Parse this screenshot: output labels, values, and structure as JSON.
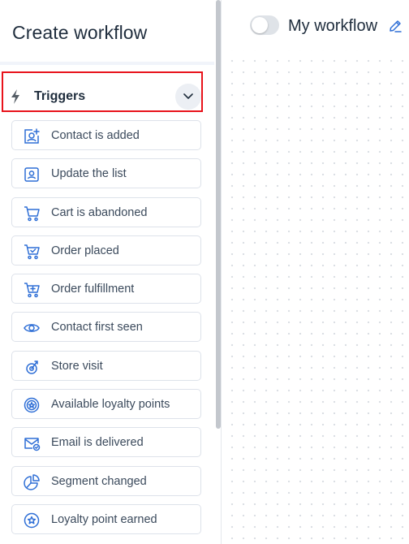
{
  "sidebar": {
    "title": "Create workflow",
    "section": {
      "label": "Triggers"
    },
    "items": [
      {
        "label": "Contact is added",
        "icon": "contact-add-icon"
      },
      {
        "label": "Update the list",
        "icon": "contact-card-icon"
      },
      {
        "label": "Cart is abandoned",
        "icon": "cart-icon"
      },
      {
        "label": "Order placed",
        "icon": "cart-check-icon"
      },
      {
        "label": "Order fulfillment",
        "icon": "cart-plus-icon"
      },
      {
        "label": "Contact first seen",
        "icon": "eye-icon"
      },
      {
        "label": "Store visit",
        "icon": "store-visit-icon"
      },
      {
        "label": "Available loyalty points",
        "icon": "loyalty-badge-icon"
      },
      {
        "label": "Email is delivered",
        "icon": "email-delivered-icon"
      },
      {
        "label": "Segment changed",
        "icon": "pie-chart-icon"
      },
      {
        "label": "Loyalty point earned",
        "icon": "loyalty-star-icon"
      }
    ]
  },
  "header": {
    "workflow_name": "My workflow",
    "toggle_on": false
  },
  "colors": {
    "accent_icon": "#2f6fd6",
    "highlight_border": "#e8131b",
    "text": "#1f2d3d"
  }
}
